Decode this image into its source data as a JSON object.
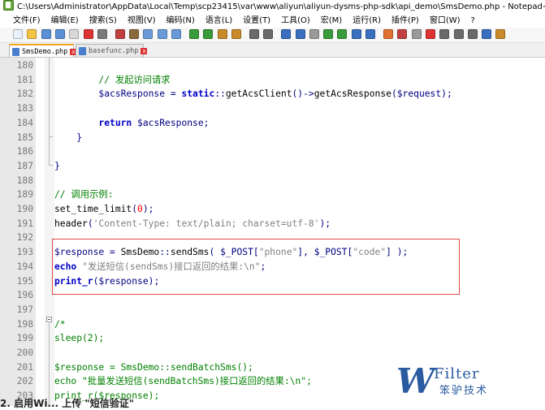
{
  "window": {
    "title": "C:\\Users\\Administrator\\AppData\\Local\\Temp\\scp23415\\var\\www\\aliyun\\aliyun-dysms-php-sdk\\api_demo\\SmsDemo.php - Notepad++"
  },
  "menu": [
    "文件(F)",
    "编辑(E)",
    "搜索(S)",
    "视图(V)",
    "编码(N)",
    "语言(L)",
    "设置(T)",
    "工具(O)",
    "宏(M)",
    "运行(R)",
    "插件(P)",
    "窗口(W)",
    "?"
  ],
  "tabs": [
    {
      "label": "SmsDemo.php",
      "active": true
    },
    {
      "label": "basefunc.php",
      "active": false
    }
  ],
  "code_lines": [
    {
      "num": "180",
      "tokens": []
    },
    {
      "num": "181",
      "tokens": [
        {
          "t": "        "
        },
        {
          "t": "// 发起访问请求",
          "c": "cmt"
        }
      ]
    },
    {
      "num": "182",
      "tokens": [
        {
          "t": "        "
        },
        {
          "t": "$acsResponse",
          "c": "var"
        },
        {
          "t": " = ",
          "c": "op"
        },
        {
          "t": "static",
          "c": "kw"
        },
        {
          "t": "::",
          "c": "op"
        },
        {
          "t": "getAcsClient"
        },
        {
          "t": "()->",
          "c": "op"
        },
        {
          "t": "getAcsResponse"
        },
        {
          "t": "(",
          "c": "op"
        },
        {
          "t": "$request",
          "c": "var"
        },
        {
          "t": ");",
          "c": "op"
        }
      ]
    },
    {
      "num": "183",
      "tokens": []
    },
    {
      "num": "184",
      "tokens": [
        {
          "t": "        "
        },
        {
          "t": "return",
          "c": "kw"
        },
        {
          "t": " "
        },
        {
          "t": "$acsResponse",
          "c": "var"
        },
        {
          "t": ";",
          "c": "op"
        }
      ]
    },
    {
      "num": "185",
      "tokens": [
        {
          "t": "    "
        },
        {
          "t": "}",
          "c": "op"
        }
      ]
    },
    {
      "num": "186",
      "tokens": []
    },
    {
      "num": "187",
      "tokens": [
        {
          "t": "}",
          "c": "op"
        }
      ]
    },
    {
      "num": "188",
      "tokens": []
    },
    {
      "num": "189",
      "tokens": [
        {
          "t": "// 调用示例:",
          "c": "cmt"
        }
      ]
    },
    {
      "num": "190",
      "tokens": [
        {
          "t": "set_time_limit"
        },
        {
          "t": "(",
          "c": "op"
        },
        {
          "t": "0",
          "c": "num"
        },
        {
          "t": ");",
          "c": "op"
        }
      ]
    },
    {
      "num": "191",
      "tokens": [
        {
          "t": "header"
        },
        {
          "t": "(",
          "c": "op"
        },
        {
          "t": "'Content-Type: text/plain; charset=utf-8'",
          "c": "str"
        },
        {
          "t": ");",
          "c": "op"
        }
      ]
    },
    {
      "num": "192",
      "tokens": []
    },
    {
      "num": "193",
      "tokens": [
        {
          "t": "$response",
          "c": "var"
        },
        {
          "t": " = ",
          "c": "op"
        },
        {
          "t": "SmsDemo"
        },
        {
          "t": "::",
          "c": "op"
        },
        {
          "t": "sendSms"
        },
        {
          "t": "( ",
          "c": "op"
        },
        {
          "t": "$_POST",
          "c": "var"
        },
        {
          "t": "[",
          "c": "op"
        },
        {
          "t": "\"phone\"",
          "c": "str"
        },
        {
          "t": "], ",
          "c": "op"
        },
        {
          "t": "$_POST",
          "c": "var"
        },
        {
          "t": "[",
          "c": "op"
        },
        {
          "t": "\"code\"",
          "c": "str"
        },
        {
          "t": "] );",
          "c": "op"
        }
      ]
    },
    {
      "num": "194",
      "tokens": [
        {
          "t": "echo",
          "c": "kw"
        },
        {
          "t": " "
        },
        {
          "t": "\"发送短信(sendSms)接口返回的结果:\\n\"",
          "c": "str"
        },
        {
          "t": ";",
          "c": "op"
        }
      ]
    },
    {
      "num": "195",
      "tokens": [
        {
          "t": "print_r",
          "c": "kw"
        },
        {
          "t": "(",
          "c": "op"
        },
        {
          "t": "$response",
          "c": "var"
        },
        {
          "t": ");",
          "c": "op"
        }
      ]
    },
    {
      "num": "196",
      "tokens": []
    },
    {
      "num": "197",
      "tokens": []
    },
    {
      "num": "198",
      "tokens": [
        {
          "t": "/*",
          "c": "cmt"
        }
      ]
    },
    {
      "num": "199",
      "tokens": [
        {
          "t": "sleep(2);",
          "c": "cmt"
        }
      ]
    },
    {
      "num": "200",
      "tokens": []
    },
    {
      "num": "201",
      "tokens": [
        {
          "t": "$response = SmsDemo::sendBatchSms();",
          "c": "cmt"
        }
      ]
    },
    {
      "num": "202",
      "tokens": [
        {
          "t": "echo \"批量发送短信(sendBatchSms)接口返回的结果:\\n\";",
          "c": "cmt"
        }
      ]
    },
    {
      "num": "203",
      "tokens": [
        {
          "t": "print_r($response);",
          "c": "cmt"
        }
      ]
    }
  ],
  "watermark": {
    "letter": "W",
    "name": "Filter",
    "sub": "笨驴技术"
  },
  "footer_text": "2. 启用Wi... 上传 \"短信验证\""
}
